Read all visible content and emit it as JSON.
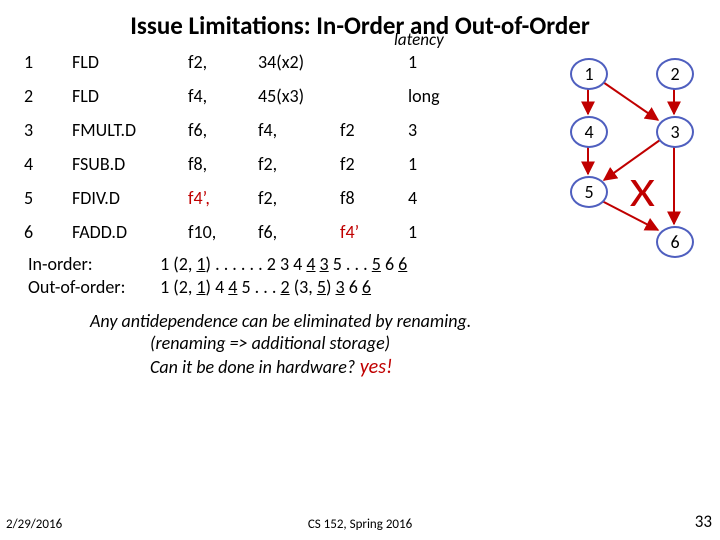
{
  "title": "Issue Limitations: In-Order and Out-of-Order",
  "latency_header": "latency",
  "rows": [
    {
      "n": "1",
      "op": "FLD",
      "d": "f2,",
      "s1": "34(x2)",
      "s2": "",
      "lat": "1",
      "red_d": false,
      "red_s2": false
    },
    {
      "n": "2",
      "op": "FLD",
      "d": "f4,",
      "s1": "45(x3)",
      "s2": "",
      "lat": "long",
      "red_d": false,
      "red_s2": false
    },
    {
      "n": "3",
      "op": "FMULT.D",
      "d": "f6,",
      "s1": "f4,",
      "s2": "f2",
      "lat": "3",
      "red_d": false,
      "red_s2": false
    },
    {
      "n": "4",
      "op": "FSUB.D",
      "d": "f8,",
      "s1": "f2,",
      "s2": "f2",
      "lat": "1",
      "red_d": false,
      "red_s2": false
    },
    {
      "n": "5",
      "op": "FDIV.D",
      "d": "f4’,",
      "s1": "f2,",
      "s2": "f8",
      "lat": "4",
      "red_d": true,
      "red_s2": false
    },
    {
      "n": "6",
      "op": "FADD.D",
      "d": "f10,",
      "s1": "f6,",
      "s2": "f4’",
      "lat": "1",
      "red_d": false,
      "red_s2": true
    }
  ],
  "seq": {
    "in_label": "In-order:",
    "in_line": "1 (2, <u>1</u>) .  .  .  .  .  .  2 3 4 <u>4</u> <u>3</u> 5 .  .  . <u>5</u> 6 <u>6</u>",
    "out_label": "Out-of-order:",
    "out_line": "1 (2, <u>1</u>) 4 <u>4</u> 5 .  .  .  <u>2</u> (3, <u>5</u>) <u>3</u> 6 <u>6</u>"
  },
  "note_l1": "Any antidependence can be eliminated by renaming.",
  "note_l2": "(renaming  => additional storage)",
  "note_l3": "Can it be done in hardware?",
  "yes": "  yes!",
  "nodes": {
    "n1": "1",
    "n2": "2",
    "n3": "3",
    "n4": "4",
    "n5": "5",
    "n6": "6"
  },
  "footer": {
    "date": "2/29/2016",
    "course": "CS 152, Spring 2016",
    "page": "33"
  }
}
